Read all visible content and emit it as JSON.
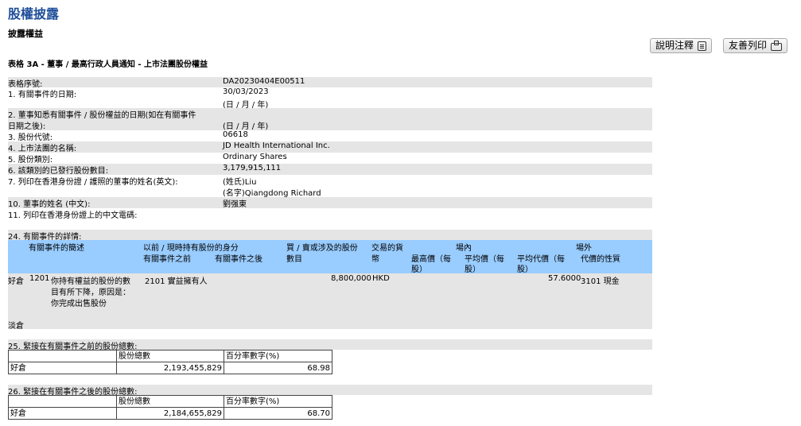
{
  "header": {
    "title": "股權披露",
    "subtitle": "披露權益",
    "buttons": {
      "notes": "說明注釋",
      "print": "友善列印"
    },
    "form_title": "表格 3A - 董事 / 最高行政人員通知 - 上市法團股份權益"
  },
  "fields": {
    "form_serial_label": "表格序號:",
    "form_serial_value": "DA20230404E00511",
    "f1_label": "1. 有關事件的日期:",
    "f1_value": "30/03/2023",
    "f1_note": "(日 / 月 / 年)",
    "f2_label_line1": "2. 董事知悉有關事件 / 股份權益的日期(如在有關事件",
    "f2_label_line2": "日期之後):",
    "f2_note": "(日 / 月 / 年)",
    "f3_label": "3. 股份代號:",
    "f3_value": "06618",
    "f4_label": "4. 上市法團的名稱:",
    "f4_value": "JD Health International Inc.",
    "f5_label": "5. 股份類別:",
    "f5_value": "Ordinary Shares",
    "f6_label": "6. 該類別的已發行股份數目:",
    "f6_value": "3,179,915,111",
    "f7_label": "7. 列印在香港身份證 / 護照的董事的姓名(英文):",
    "f7_value_line1": "(姓氏)Liu",
    "f7_value_line2": "(名字)Qiangdong Richard",
    "f10_label": "10. 董事的姓名 (中文):",
    "f10_value": "劉强東",
    "f11_label": "11. 列印在香港身份證上的中文電碼:"
  },
  "section24": {
    "heading": "24. 有關事件的詳情:",
    "headers": {
      "event_desc": "有關事件的簡述",
      "capacity_line1": "以前 / 現時持有股份的身分",
      "capacity_before": "有關事件之前",
      "capacity_after": "有關事件之後",
      "shares_line1": "買 / 賣或涉及的股份",
      "shares_line2": "數目",
      "currency_line1": "交易的貨",
      "currency_line2": "幣",
      "onex_label": "場內",
      "onex_high_line1": "最高價（每",
      "onex_high_line2": "股）",
      "onex_avg_line1": "平均價（每",
      "onex_avg_line2": "股）",
      "offex_label": "場外",
      "offex_avg_line1": "平均代價（每",
      "offex_avg_line2": "股）",
      "offex_nature": "代價的性質"
    },
    "row": {
      "position": "好倉",
      "event_code": "1201",
      "event_desc_line1": "你持有權益的股份的數",
      "event_desc_line2": "目有所下降，原因是：",
      "event_desc_line3": "你完成出售股份",
      "capacity_before": "2101 實益擁有人",
      "shares": "8,800,000",
      "currency": "HKD",
      "offex_avg": "57.6000",
      "nature": "3101 現金"
    },
    "short_label": "淡倉"
  },
  "section25": {
    "heading": "25. 緊接在有關事件之前的股份總數:",
    "col_shares": "股份總數",
    "col_pct": "百分率數字(%)",
    "position": "好倉",
    "shares": "2,193,455,829",
    "pct": "68.98"
  },
  "section26": {
    "heading": "26. 緊接在有關事件之後的股份總數:",
    "col_shares": "股份總數",
    "col_pct": "百分率數字(%)",
    "position": "好倉",
    "shares": "2,184,655,829",
    "pct": "68.70"
  },
  "icons": {
    "notes": "notes-icon",
    "print": "printer-icon"
  },
  "colors": {
    "title": "#1f4e99",
    "header_bg": "#99ccff",
    "row_grey": "#e5e5e5"
  }
}
